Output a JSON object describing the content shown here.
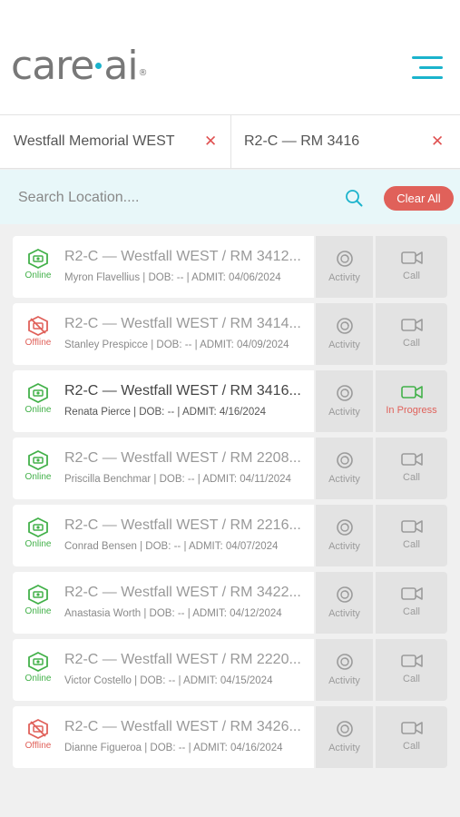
{
  "header": {
    "logo_text_left": "care",
    "logo_text_right": "ai",
    "logo_reg": "®"
  },
  "filters": [
    {
      "label": "Westfall Memorial WEST",
      "close": "✕"
    },
    {
      "label": "R2-C — RM 3416",
      "close": "✕"
    }
  ],
  "search": {
    "placeholder": "Search Location....",
    "clear_label": "Clear All"
  },
  "colors": {
    "accent": "#1bb3cc",
    "online": "#43b14a",
    "offline": "#e0615a",
    "clear_button": "#e0615a"
  },
  "rooms": [
    {
      "status": "Online",
      "room": "R2-C — Westfall WEST / RM 3412...",
      "patient": "Myron Flavellius | DOB: -- | ADMIT: 04/06/2024",
      "activity": "Activity",
      "call": "Call"
    },
    {
      "status": "Offline",
      "room": "R2-C — Westfall WEST / RM 3414...",
      "patient": "Stanley Prespicce | DOB: -- | ADMIT: 04/09/2024",
      "activity": "Activity",
      "call": "Call"
    },
    {
      "status": "Online",
      "room": "R2-C — Westfall WEST / RM 3416...",
      "patient": "Renata Pierce | DOB: -- | ADMIT:  4/16/2024",
      "activity": "Activity",
      "call": "In Progress"
    },
    {
      "status": "Online",
      "room": "R2-C — Westfall WEST / RM 2208...",
      "patient": "Priscilla Benchmar | DOB: -- | ADMIT: 04/11/2024",
      "activity": "Activity",
      "call": "Call"
    },
    {
      "status": "Online",
      "room": "R2-C — Westfall WEST / RM 2216...",
      "patient": "Conrad Bensen | DOB: -- | ADMIT: 04/07/2024",
      "activity": "Activity",
      "call": "Call"
    },
    {
      "status": "Online",
      "room": "R2-C — Westfall WEST / RM 3422...",
      "patient": "Anastasia Worth | DOB: -- | ADMIT:  04/12/2024",
      "activity": "Activity",
      "call": "Call"
    },
    {
      "status": "Online",
      "room": "R2-C — Westfall WEST / RM 2220...",
      "patient": "Victor Costello | DOB: -- | ADMIT:  04/15/2024",
      "activity": "Activity",
      "call": "Call"
    },
    {
      "status": "Offline",
      "room": "R2-C — Westfall WEST / RM 3426...",
      "patient": "Dianne Figueroa | DOB: -- | ADMIT: 04/16/2024",
      "activity": "Activity",
      "call": "Call"
    }
  ]
}
